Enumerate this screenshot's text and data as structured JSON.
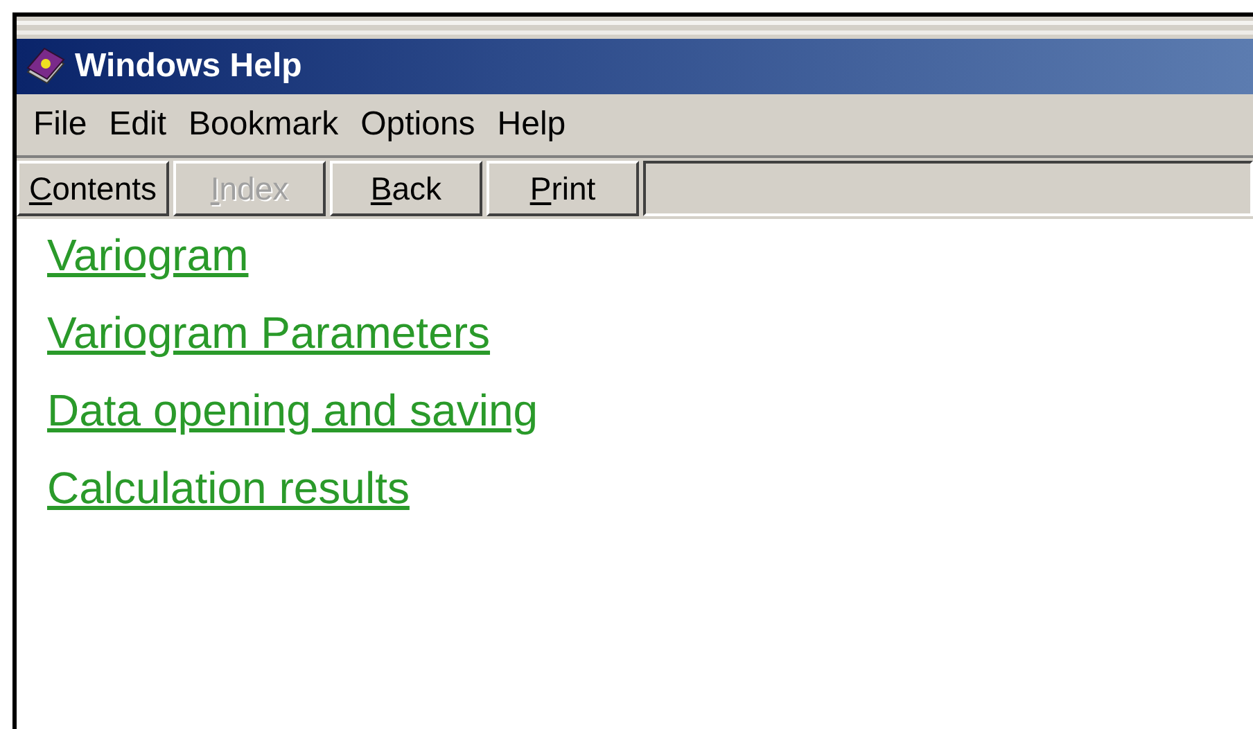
{
  "window": {
    "title": "Windows Help"
  },
  "menu": [
    "File",
    "Edit",
    "Bookmark",
    "Options",
    "Help"
  ],
  "toolbar": [
    {
      "label": "Contents",
      "disabled": false
    },
    {
      "label": "Index",
      "disabled": true
    },
    {
      "label": "Back",
      "disabled": false
    },
    {
      "label": "Print",
      "disabled": false
    }
  ],
  "links": [
    "Variogram",
    "Variogram Parameters",
    "Data opening and saving",
    "Calculation results"
  ]
}
